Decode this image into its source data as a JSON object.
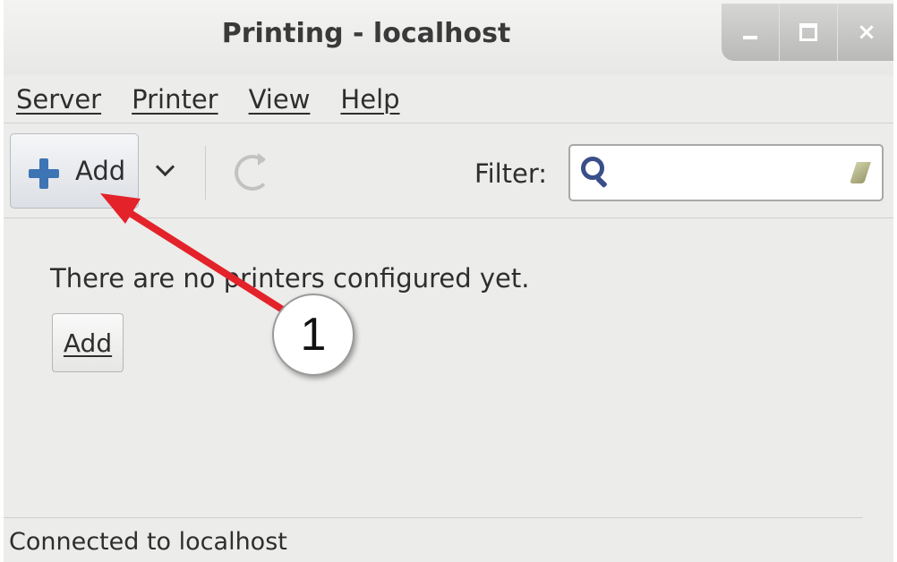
{
  "window": {
    "title": "Printing - localhost",
    "controls": [
      "minimize",
      "maximize",
      "close"
    ],
    "close_glyph": "×"
  },
  "menubar": {
    "items": [
      {
        "label": "Server"
      },
      {
        "label": "Printer"
      },
      {
        "label": "View"
      },
      {
        "label": "Help"
      }
    ]
  },
  "toolbar": {
    "add_label": "Add",
    "add_icon": "plus-icon",
    "dropdown_icon": "chevron-down-icon",
    "refresh_icon": "refresh-icon",
    "filter_label": "Filter:",
    "filter_value": "",
    "search_icon": "search-icon",
    "clear_icon": "clear-icon"
  },
  "content": {
    "message": "There are no printers configured yet.",
    "add_button_label": "Add"
  },
  "statusbar": {
    "text": "Connected to localhost"
  },
  "annotation": {
    "callout_number": "1",
    "arrow_color": "#e3222a"
  },
  "colors": {
    "accent_blue": "#3d74b4",
    "window_bg": "#ececea"
  }
}
